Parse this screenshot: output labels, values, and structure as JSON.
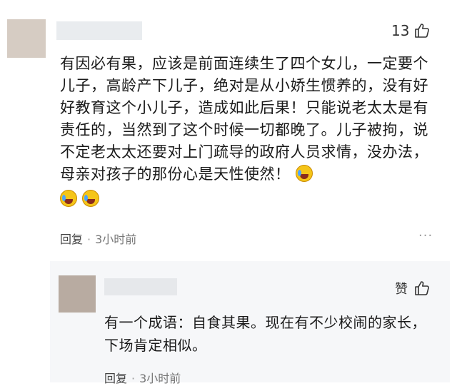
{
  "comment": {
    "like_count": "13",
    "text": "有因必有果，应该是前面连续生了四个女儿，一定要个儿子，高龄产下儿子，绝对是从小娇生惯养的，没有好好教育这个小儿子，造成如此后果！只能说老太太是有责任的，当然到了这个时候一切都晚了。儿子被拘，说不定老太太还要对上门疏导的政府人员求情，没办法，母亲对孩子的那份心是天性使然！",
    "reply_label": "回复",
    "time": "3小时前",
    "emoji_icon": "crying-laughing-emoji-icon"
  },
  "reply": {
    "like_label": "赞",
    "text": "有一个成语：自食其果。现在有不少校闹的家长，下场肯定相似。",
    "reply_label": "回复",
    "time": "3小时前"
  },
  "colors": {
    "background": "#ffffff",
    "reply_background": "#f6f7f9",
    "avatar": "#cbbfb6"
  }
}
